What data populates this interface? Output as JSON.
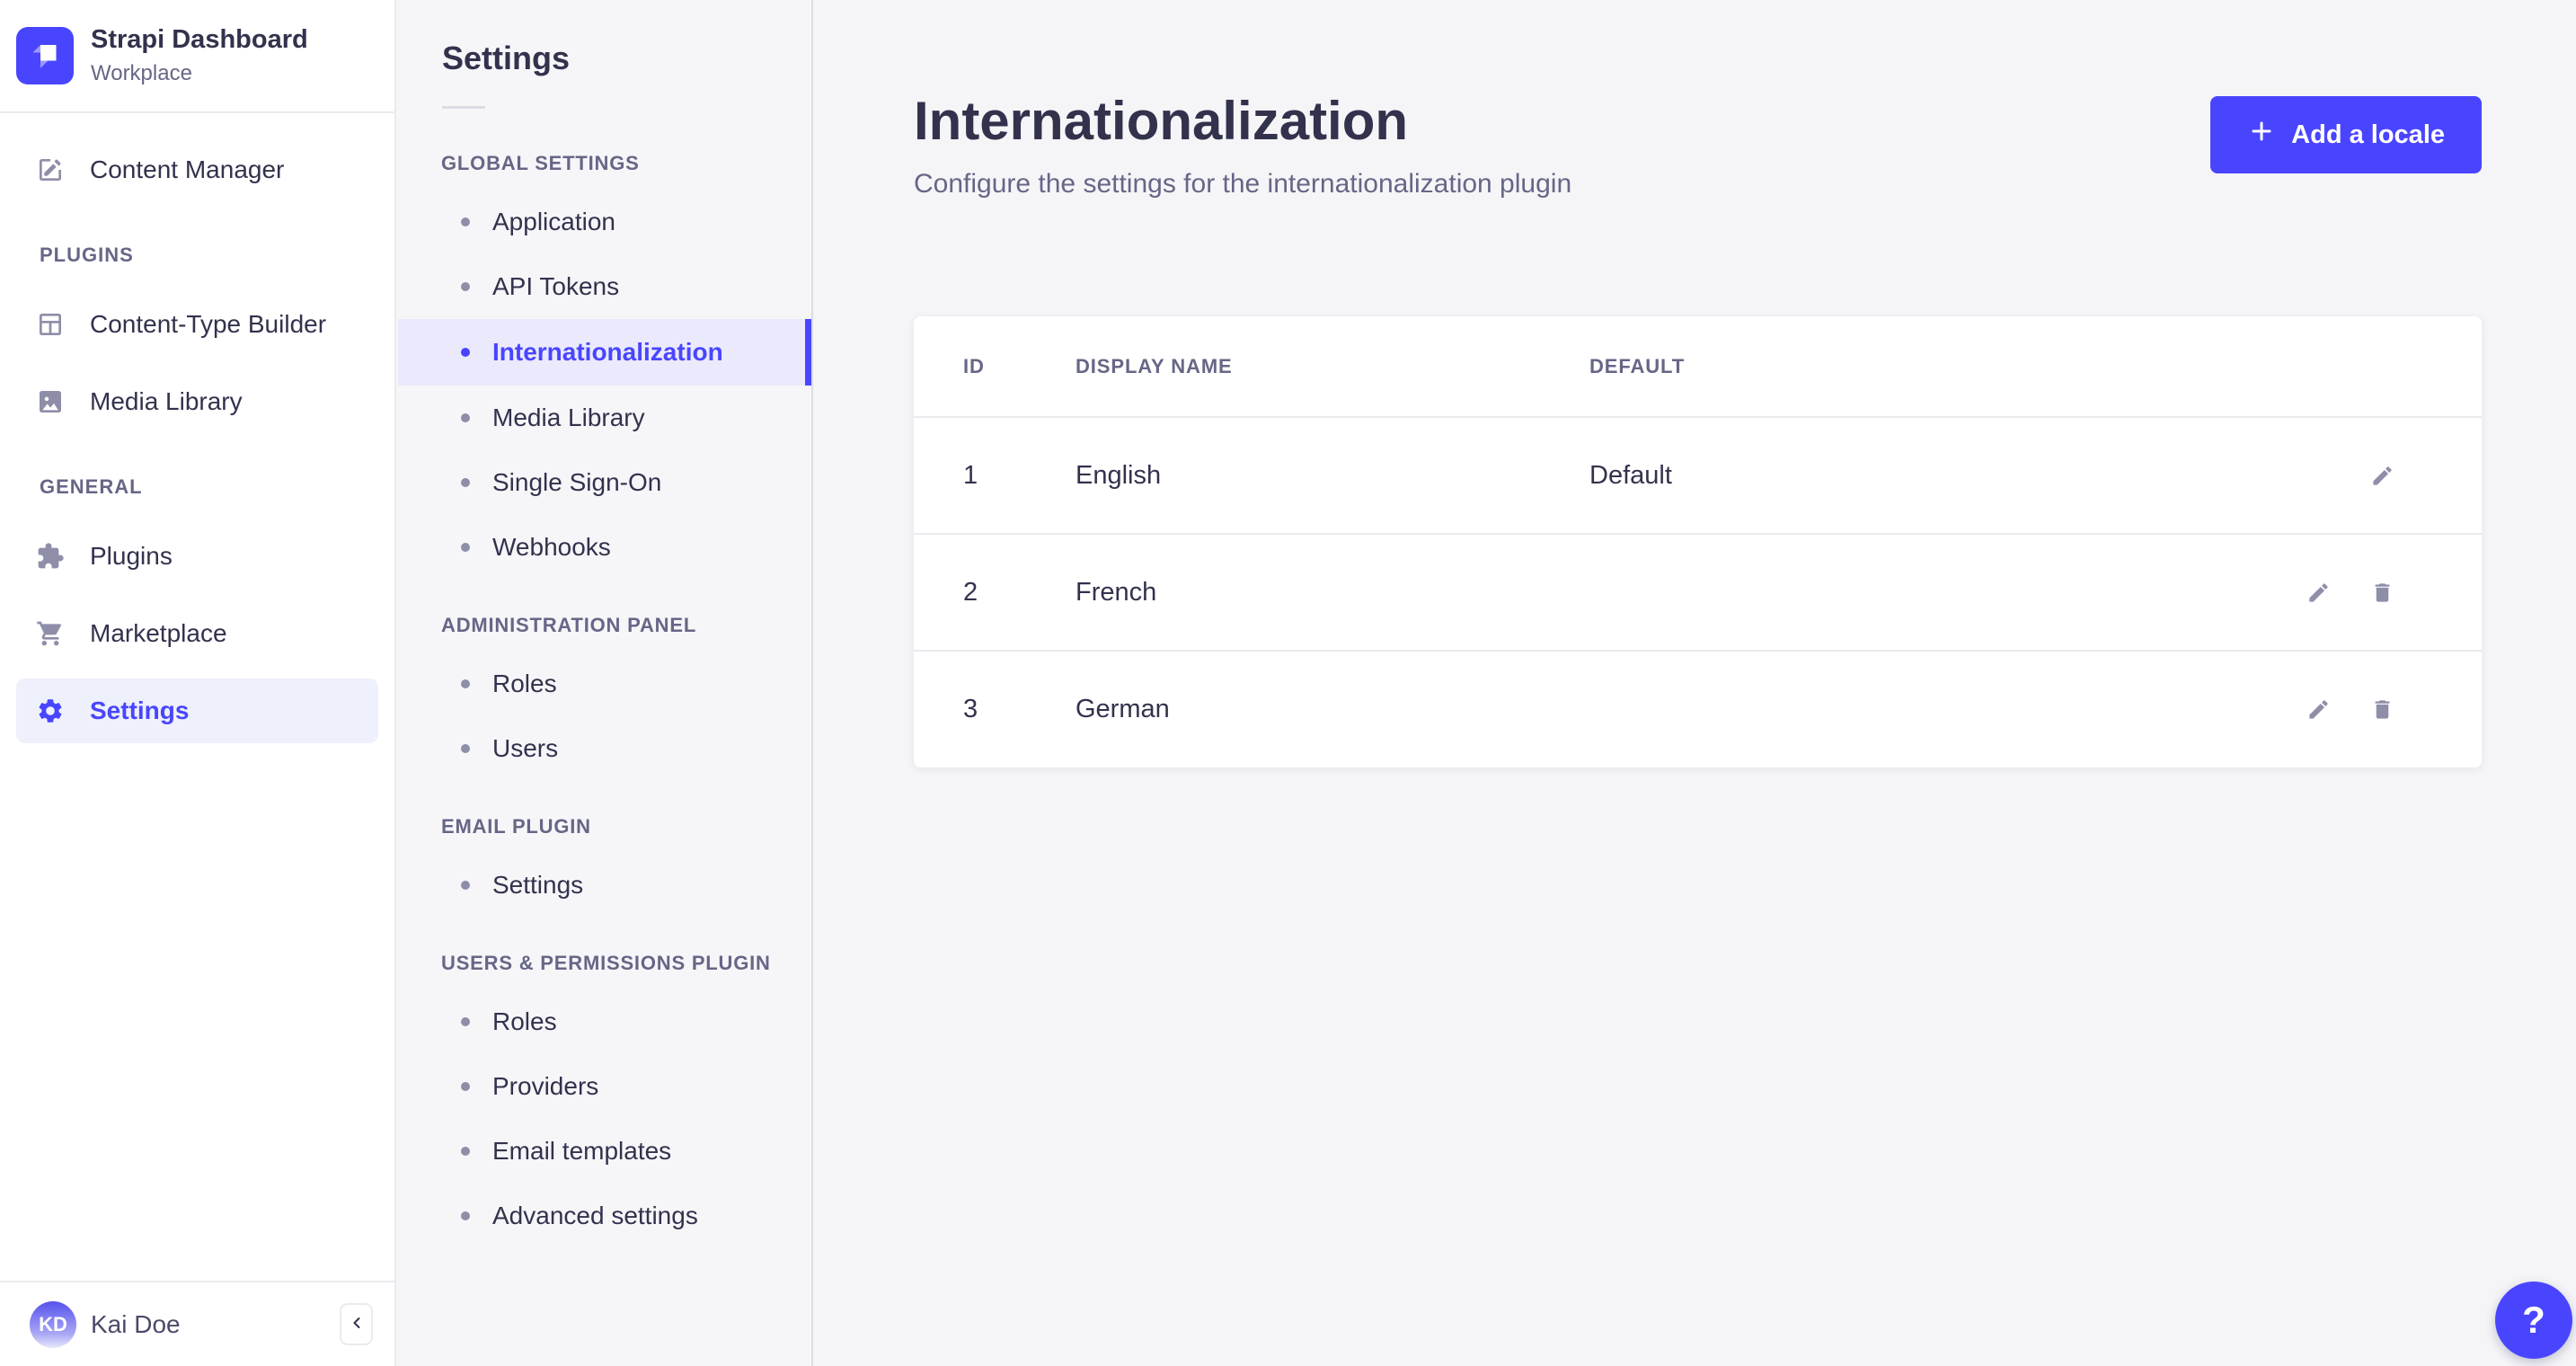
{
  "colors": {
    "primary": "#4945ff",
    "primary_active_bg": "#eef0fc",
    "subnav_active_bg": "#eaeafc",
    "text_dark": "#32324d",
    "text_muted": "#666687",
    "icon_gray": "#8e8ea9",
    "border": "#eaeaef",
    "sidebar_bg": "#ffffff",
    "subnav_bg": "#f6f6f9",
    "content_bg": "#f5f5f8"
  },
  "main_nav": {
    "brand": {
      "title": "Strapi Dashboard",
      "subtitle": "Workplace"
    },
    "content_manager": {
      "label": "Content Manager"
    },
    "sections": [
      {
        "label": "PLUGINS",
        "items": [
          {
            "label": "Content-Type Builder"
          },
          {
            "label": "Media Library"
          }
        ]
      },
      {
        "label": "GENERAL",
        "items": [
          {
            "label": "Plugins"
          },
          {
            "label": "Marketplace"
          },
          {
            "label": "Settings"
          }
        ]
      }
    ],
    "user": {
      "initials": "KD",
      "name": "Kai Doe"
    }
  },
  "sub_nav": {
    "title": "Settings",
    "sections": [
      {
        "label": "GLOBAL SETTINGS",
        "items": [
          {
            "label": "Application"
          },
          {
            "label": "API Tokens"
          },
          {
            "label": "Internationalization",
            "active": true
          },
          {
            "label": "Media Library"
          },
          {
            "label": "Single Sign-On"
          },
          {
            "label": "Webhooks"
          }
        ]
      },
      {
        "label": "ADMINISTRATION PANEL",
        "items": [
          {
            "label": "Roles"
          },
          {
            "label": "Users"
          }
        ]
      },
      {
        "label": "EMAIL PLUGIN",
        "items": [
          {
            "label": "Settings"
          }
        ]
      },
      {
        "label": "USERS & PERMISSIONS PLUGIN",
        "items": [
          {
            "label": "Roles"
          },
          {
            "label": "Providers"
          },
          {
            "label": "Email templates"
          },
          {
            "label": "Advanced settings"
          }
        ]
      }
    ]
  },
  "content": {
    "title": "Internationalization",
    "subtitle": "Configure the settings for the internationalization plugin",
    "add_button_label": "Add a locale",
    "table": {
      "headers": [
        "ID",
        "DISPLAY NAME",
        "DEFAULT"
      ],
      "rows": [
        {
          "id": "1",
          "name": "English",
          "default": "Default"
        },
        {
          "id": "2",
          "name": "French",
          "default": ""
        },
        {
          "id": "3",
          "name": "German",
          "default": ""
        }
      ]
    }
  },
  "help": {
    "label": "?"
  }
}
